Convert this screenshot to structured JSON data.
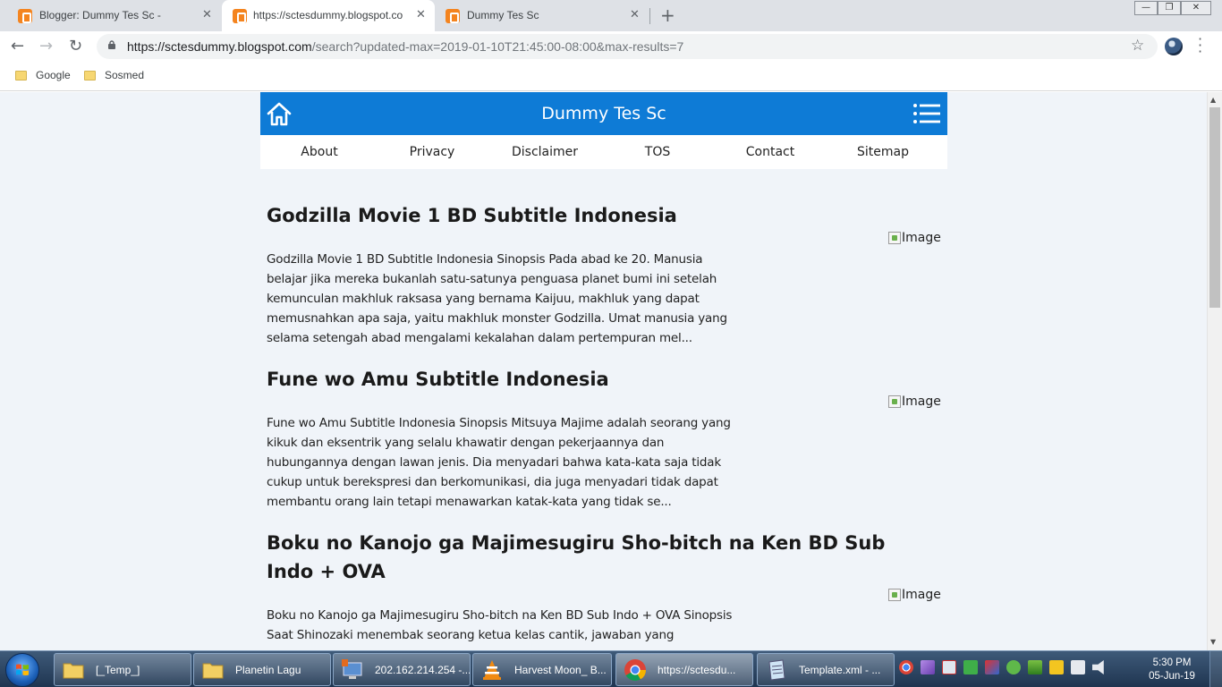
{
  "browser": {
    "tabs": [
      {
        "title": "Blogger: Dummy Tes Sc -",
        "active": false
      },
      {
        "title": "https://sctesdummy.blogspot.co",
        "active": true
      },
      {
        "title": "Dummy Tes Sc",
        "active": false
      }
    ],
    "close_glyph": "✕",
    "new_tab_glyph": "+",
    "url_host": "https://sctesdummy.blogspot.com",
    "url_path": "/search?updated-max=2019-01-10T21:45:00-08:00&max-results=7",
    "bookmarks": [
      "Google",
      "Sosmed"
    ],
    "accent": "#f4841f"
  },
  "blog": {
    "title": "Dummy Tes Sc",
    "header_color": "#0e7bd6",
    "nav": [
      "About",
      "Privacy",
      "Disclaimer",
      "TOS",
      "Contact",
      "Sitemap"
    ],
    "image_alt": "Image",
    "posts": [
      {
        "title": "Godzilla Movie 1 BD Subtitle Indonesia",
        "snippet": "Godzilla Movie 1 BD Subtitle Indonesia Sinopsis Pada abad ke 20. Manusia belajar jika mereka bukanlah satu-satunya penguasa planet bumi ini setelah kemunculan makhluk raksasa yang bernama Kaijuu, makhluk yang dapat memusnahkan apa saja, yaitu makhluk monster Godzilla. Umat manusia yang selama setengah abad mengalami kekalahan dalam pertempuran mel..."
      },
      {
        "title": "Fune wo Amu Subtitle Indonesia",
        "snippet": "Fune wo Amu Subtitle Indonesia Sinopsis Mitsuya Majime adalah seorang yang kikuk dan eksentrik yang selalu khawatir dengan pekerjaannya dan hubungannya dengan lawan jenis. Dia menyadari bahwa kata-kata saja tidak cukup untuk berekspresi dan berkomunikasi, dia juga menyadari tidak dapat membantu orang lain tetapi menawarkan katak-kata yang tidak se..."
      },
      {
        "title": "Boku no Kanojo ga Majimesugiru Sho-bitch na Ken BD Sub Indo + OVA",
        "snippet": "Boku no Kanojo ga Majimesugiru Sho-bitch na Ken BD Sub Indo + OVA Sinopsis Saat Shinozaki menembak seorang ketua kelas cantik, jawaban yang"
      }
    ]
  },
  "taskbar": {
    "items": [
      {
        "label": "[_Temp_]",
        "icon": "folder-icon"
      },
      {
        "label": "Planetin Lagu",
        "icon": "folder-icon"
      },
      {
        "label": "202.162.214.254 -...",
        "icon": "remote-desktop-icon"
      },
      {
        "label": "Harvest Moon_ B...",
        "icon": "vlc-icon"
      },
      {
        "label": "https://sctesdu...",
        "icon": "chrome-icon"
      },
      {
        "label": "Template.xml - ...",
        "icon": "notepad-icon"
      }
    ],
    "time": "5:30 PM",
    "date": "05-Jun-19"
  }
}
